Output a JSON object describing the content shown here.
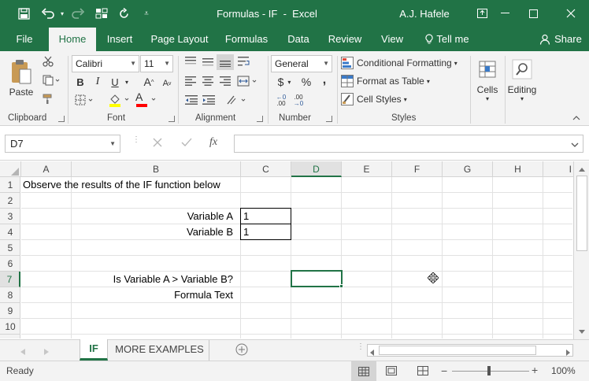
{
  "title_bar": {
    "doc_title": "Formulas - IF  -  Excel",
    "user": "A.J. Hafele",
    "save_icon": "save-icon",
    "undo_icon": "undo-icon",
    "redo_icon": "redo-icon",
    "customize_icon": "qat-customize-icon",
    "ribbon_display_icon": "ribbon-display-options-icon",
    "minimize_icon": "minimize-icon",
    "restore_icon": "restore-icon",
    "close_icon": "close-icon"
  },
  "tabs": [
    "File",
    "Home",
    "Insert",
    "Page Layout",
    "Formulas",
    "Data",
    "Review",
    "View"
  ],
  "tell_me": "Tell me",
  "share": "Share",
  "ribbon": {
    "clipboard": {
      "paste": "Paste",
      "label": "Clipboard"
    },
    "font": {
      "name": "Calibri",
      "size": "11",
      "bold": "B",
      "italic": "I",
      "underline": "U",
      "grow": "A",
      "shrink": "A",
      "font_color_letter": "A",
      "label": "Font"
    },
    "alignment": {
      "label": "Alignment"
    },
    "number": {
      "format": "General",
      "currency": "$",
      "percent": "%",
      "comma": ",",
      "inc_decimal": ".00",
      "dec_decimal": ".00",
      "label": "Number"
    },
    "styles": {
      "conditional": "Conditional Formatting",
      "table": "Format as Table",
      "cell_styles": "Cell Styles",
      "label": "Styles"
    },
    "cells": {
      "label": "Cells"
    },
    "editing": {
      "label": "Editing"
    },
    "accent_color": "#217346"
  },
  "formula_bar": {
    "name_box": "D7",
    "fx": "fx",
    "formula": ""
  },
  "columns": [
    "A",
    "B",
    "C",
    "D",
    "E",
    "F",
    "G",
    "H",
    "I"
  ],
  "selected_column": "D",
  "rows": [
    "1",
    "2",
    "3",
    "4",
    "5",
    "6",
    "7",
    "8",
    "9",
    "10"
  ],
  "selected_row": "7",
  "cells": {
    "A1": "Observe the results of the IF function below",
    "B3": "Variable A",
    "C3": "1",
    "B4": "Variable B",
    "C4": "1",
    "B7": "Is Variable A > Variable B?",
    "B8": "Formula Text"
  },
  "sheets": [
    "IF",
    "MORE EXAMPLES"
  ],
  "active_sheet": "IF",
  "status": {
    "ready": "Ready",
    "zoom": "100%"
  }
}
